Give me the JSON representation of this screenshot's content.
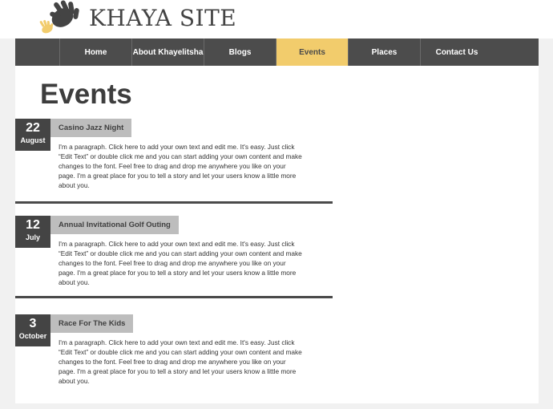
{
  "site": {
    "title": "KHAYA SITE"
  },
  "nav": {
    "items": [
      {
        "label": "Home"
      },
      {
        "label": "About Khayelitsha"
      },
      {
        "label": "Blogs"
      },
      {
        "label": "Events"
      },
      {
        "label": "Places"
      },
      {
        "label": "Contact Us"
      }
    ],
    "active": "Events"
  },
  "page": {
    "title": "Events"
  },
  "events": [
    {
      "day": "22",
      "month": "August",
      "title": "Casino Jazz Night",
      "text": "I'm a paragraph. Click here to add your own text and edit me. It's easy. Just click “Edit Text” or double click me and you can start adding your own content and make changes to the font. Feel free to drag and drop me anywhere you like on your page. I'm a great place for you to tell a story and let your users know a little more about you."
    },
    {
      "day": "12",
      "month": "July",
      "title": "Annual Invitational Golf Outing",
      "text": "I'm a paragraph. Click here to add your own text and edit me. It's easy. Just click “Edit Text” or double click me and you can start adding your own content and make changes to the font. Feel free to drag and drop me anywhere you like on your page. I'm a great place for you to tell a story and let your users know a little more about you."
    },
    {
      "day": "3",
      "month": "October",
      "title": "Race For The Kids",
      "text": "I'm a paragraph. Click here to add your own text and edit me. It's easy. Just click “Edit Text” or double click me and you can start adding your own content and make changes to the font. Feel free to drag and drop me anywhere you like on your page. I'm a great place for you to tell a story and let your users know a little more about you."
    }
  ],
  "colors": {
    "accent": "#f2cc6c",
    "nav_bg": "#4c4c4c",
    "badge_bg": "#444444",
    "title_tab_bg": "#bdbdbd"
  },
  "icons": {
    "logo": "hand-icon"
  }
}
